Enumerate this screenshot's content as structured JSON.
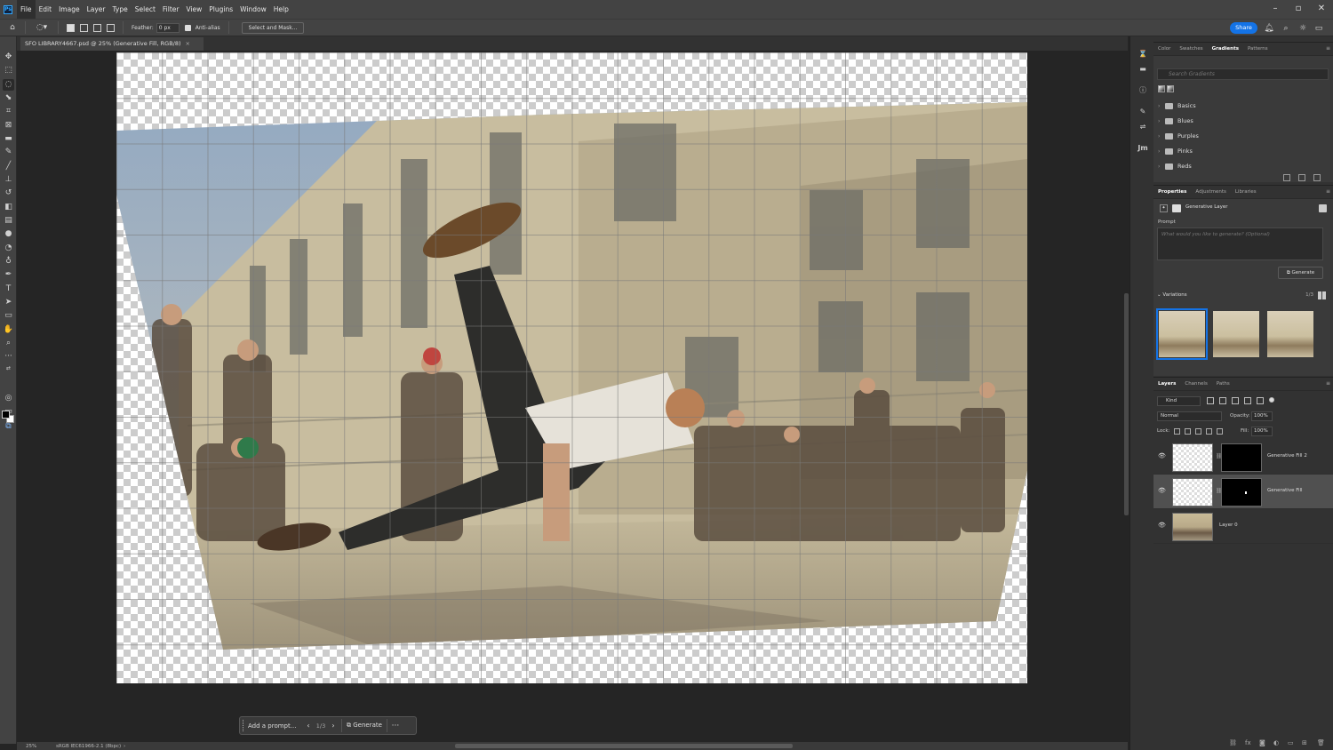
{
  "menubar": {
    "logo": "Ps",
    "items": [
      "File",
      "Edit",
      "Image",
      "Layer",
      "Type",
      "Select",
      "Filter",
      "View",
      "Plugins",
      "Window",
      "Help"
    ]
  },
  "options": {
    "feather_label": "Feather:",
    "feather_value": "0 px",
    "antialias_label": "Anti-alias",
    "select_mask_label": "Select and Mask...",
    "share_label": "Share"
  },
  "document": {
    "tab_title": "SFO LIBRARY4667.psd @ 25% (Generative Fill, RGB/8)",
    "zoom": "25%",
    "profile": "sRGB IEC61966-2.1 (8bpc)"
  },
  "taskbar": {
    "prompt_placeholder": "Add a prompt...",
    "count": "1/3",
    "generate_label": "Generate",
    "more": "···"
  },
  "gradients_panel": {
    "tabs": [
      "Color",
      "Swatches",
      "Gradients",
      "Patterns"
    ],
    "active_tab": "Gradients",
    "search_placeholder": "Search Gradients",
    "folders": [
      "Basics",
      "Blues",
      "Purples",
      "Pinks",
      "Reds"
    ]
  },
  "properties_panel": {
    "tabs": [
      "Properties",
      "Adjustments",
      "Libraries"
    ],
    "layer_type": "Generative Layer",
    "prompt_label": "Prompt",
    "prompt_placeholder": "What would you like to generate? (Optional)",
    "generate_label": "Generate",
    "variations_label": "Variations",
    "variations_count": "1/3"
  },
  "layers_panel": {
    "tabs": [
      "Layers",
      "Channels",
      "Paths"
    ],
    "kind_label": "Kind",
    "blend_mode": "Normal",
    "opacity_label": "Opacity:",
    "opacity_value": "100%",
    "lock_label": "Lock:",
    "fill_label": "Fill:",
    "fill_value": "100%",
    "layers": [
      {
        "name": "Generative Fill 2"
      },
      {
        "name": "Generative Fill"
      },
      {
        "name": "Layer 0"
      }
    ]
  },
  "colors": {
    "accent": "#1473e6",
    "ui_dark": "#323232",
    "ui_mid": "#434343"
  }
}
